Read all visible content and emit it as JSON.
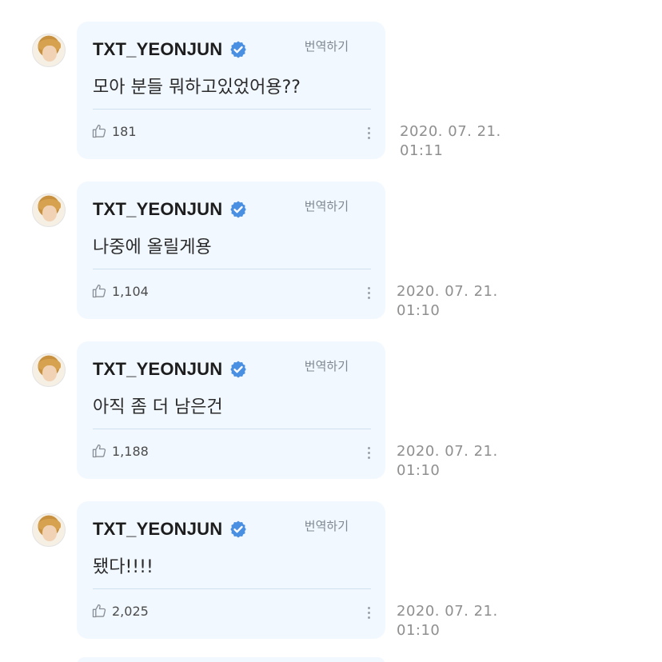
{
  "posts": [
    {
      "username": "TXT_YEONJUN",
      "translate_label": "번역하기",
      "text": "모아 분들 뭐하고있었어용??",
      "likes": "181",
      "date": "2020. 07. 21.",
      "time": "01:11"
    },
    {
      "username": "TXT_YEONJUN",
      "translate_label": "번역하기",
      "text": "나중에 올릴게용",
      "likes": "1,104",
      "date": "2020. 07. 21.",
      "time": "01:10"
    },
    {
      "username": "TXT_YEONJUN",
      "translate_label": "번역하기",
      "text": "아직 좀 더 남은건",
      "likes": "1,188",
      "date": "2020. 07. 21.",
      "time": "01:10"
    },
    {
      "username": "TXT_YEONJUN",
      "translate_label": "번역하기",
      "text": "됐다!!!!",
      "likes": "2,025",
      "date": "2020. 07. 21.",
      "time": "01:10"
    }
  ],
  "icons": {
    "verified": "verified-badge-icon",
    "like": "thumbs-up-icon",
    "more": "more-options-icon"
  },
  "colors": {
    "bubble_background": "#f1f8ff",
    "verified_blue": "#4a90e2",
    "timestamp_gray": "#8f8f8f"
  }
}
